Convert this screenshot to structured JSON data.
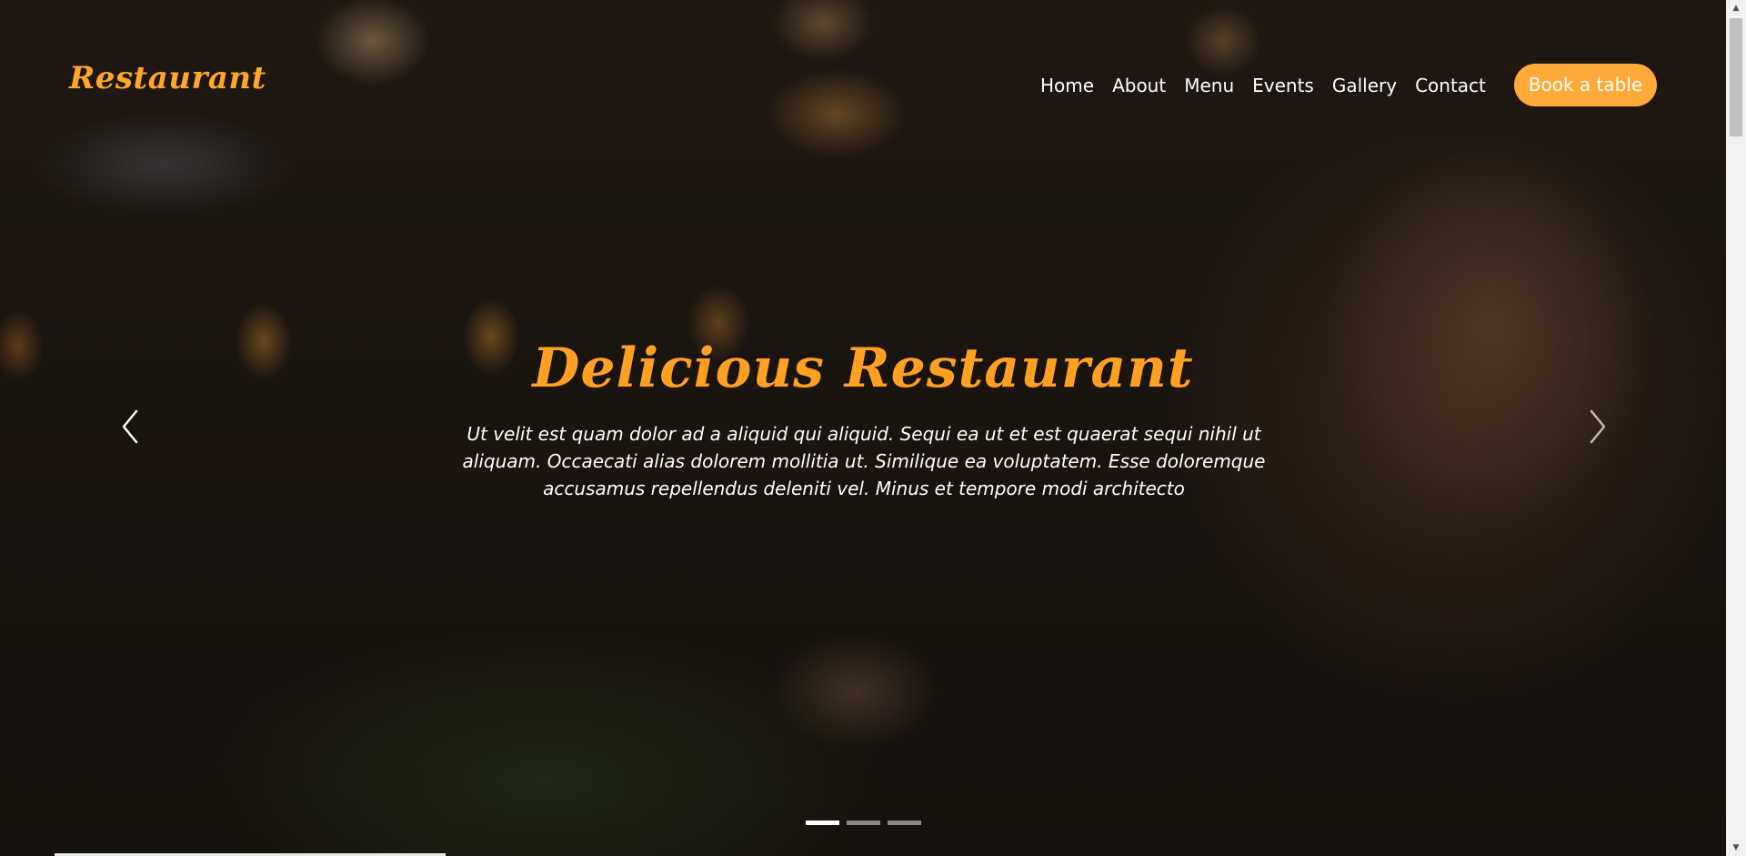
{
  "header": {
    "logo": "Restaurant",
    "nav": [
      {
        "label": "Home"
      },
      {
        "label": "About"
      },
      {
        "label": "Menu"
      },
      {
        "label": "Events"
      },
      {
        "label": "Gallery"
      },
      {
        "label": "Contact"
      }
    ],
    "cta_label": "Book a table"
  },
  "hero": {
    "title": "Delicious Restaurant",
    "text": "Ut velit est quam dolor ad a aliquid qui aliquid. Sequi ea ut et est quaerat sequi nihil ut aliquam. Occaecati alias dolorem mollitia ut. Similique ea voluptatem. Esse doloremque accusamus repellendus deleniti vel. Minus et tempore modi architecto",
    "slides_count": 3,
    "active_slide": 1
  },
  "icons": {
    "prev": "chevron-left-icon",
    "next": "chevron-right-icon"
  },
  "colors": {
    "accent": "#ffa62b",
    "button": "#ffaa38",
    "text": "#ffffff"
  }
}
